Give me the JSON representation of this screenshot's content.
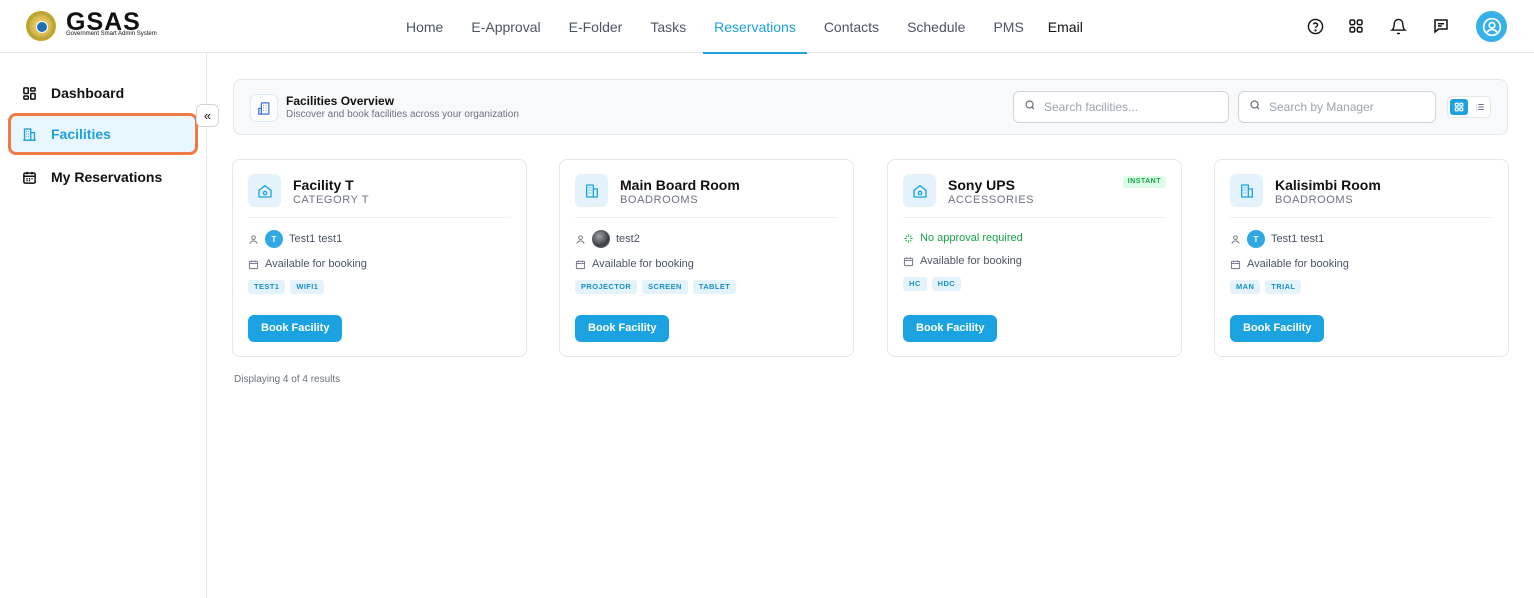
{
  "header": {
    "logo_text": "GSAS",
    "logo_sub": "Government Smart Admin System",
    "nav": [
      {
        "label": "Home"
      },
      {
        "label": "E-Approval"
      },
      {
        "label": "E-Folder"
      },
      {
        "label": "Tasks"
      },
      {
        "label": "Reservations",
        "active": true
      },
      {
        "label": "Contacts"
      },
      {
        "label": "Schedule"
      },
      {
        "label": "PMS"
      },
      {
        "label": "Email"
      }
    ],
    "icons": [
      "help-icon",
      "apps-grid-icon",
      "bell-icon",
      "chat-icon",
      "user-avatar-icon"
    ]
  },
  "sidebar": {
    "items": [
      {
        "label": "Dashboard",
        "icon": "dashboard-icon"
      },
      {
        "label": "Facilities",
        "icon": "building-icon",
        "active": true
      },
      {
        "label": "My Reservations",
        "icon": "calendar-icon"
      }
    ],
    "collapse_glyph": "«"
  },
  "overview": {
    "title": "Facilities Overview",
    "subtitle": "Discover and book facilities across your organization",
    "search_facilities_placeholder": "Search facilities...",
    "search_manager_placeholder": "Search by Manager"
  },
  "cards": [
    {
      "title": "Facility T",
      "category": "CATEGORY T",
      "manager": "Test1 test1",
      "manager_initial": "T",
      "availability": "Available for booking",
      "tags": [
        "TEST1",
        "WIFI1"
      ],
      "button": "Book Facility"
    },
    {
      "title": "Main Board Room",
      "category": "BOADROOMS",
      "manager": "test2",
      "availability": "Available for booking",
      "tags": [
        "PROJECTOR",
        "SCREEN",
        "TABLET"
      ],
      "button": "Book Facility"
    },
    {
      "title": "Sony UPS",
      "category": "ACCESSORIES",
      "badge": "INSTANT",
      "approval": "No approval required",
      "availability": "Available for booking",
      "tags": [
        "HC",
        "HDC"
      ],
      "button": "Book Facility"
    },
    {
      "title": "Kalisimbi Room",
      "category": "BOADROOMS",
      "manager": "Test1 test1",
      "manager_initial": "T",
      "availability": "Available for booking",
      "tags": [
        "MAN",
        "TRIAL"
      ],
      "button": "Book Facility"
    }
  ],
  "results_text": "Displaying 4 of 4 results",
  "colors": {
    "accent": "#1da1dc",
    "highlight_border": "#f07a44",
    "success": "#16a34a"
  }
}
